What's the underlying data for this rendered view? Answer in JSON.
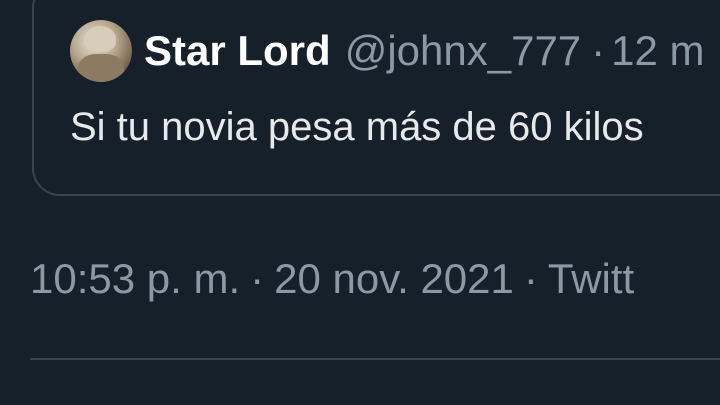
{
  "quoted_tweet": {
    "display_name": "Star Lord",
    "handle": "@johnx_777",
    "separator": "·",
    "time_ago": "12 m",
    "text": "Si tu novia pesa más de 60 kilos"
  },
  "tweet_meta": {
    "time": "10:53 p. m.",
    "separator": "·",
    "date": "20 nov. 2021",
    "source": "Twitt"
  },
  "colors": {
    "background": "#15202b",
    "border": "#38444d",
    "primary_text": "#e7e9ea",
    "secondary_text": "#8b98a5"
  }
}
